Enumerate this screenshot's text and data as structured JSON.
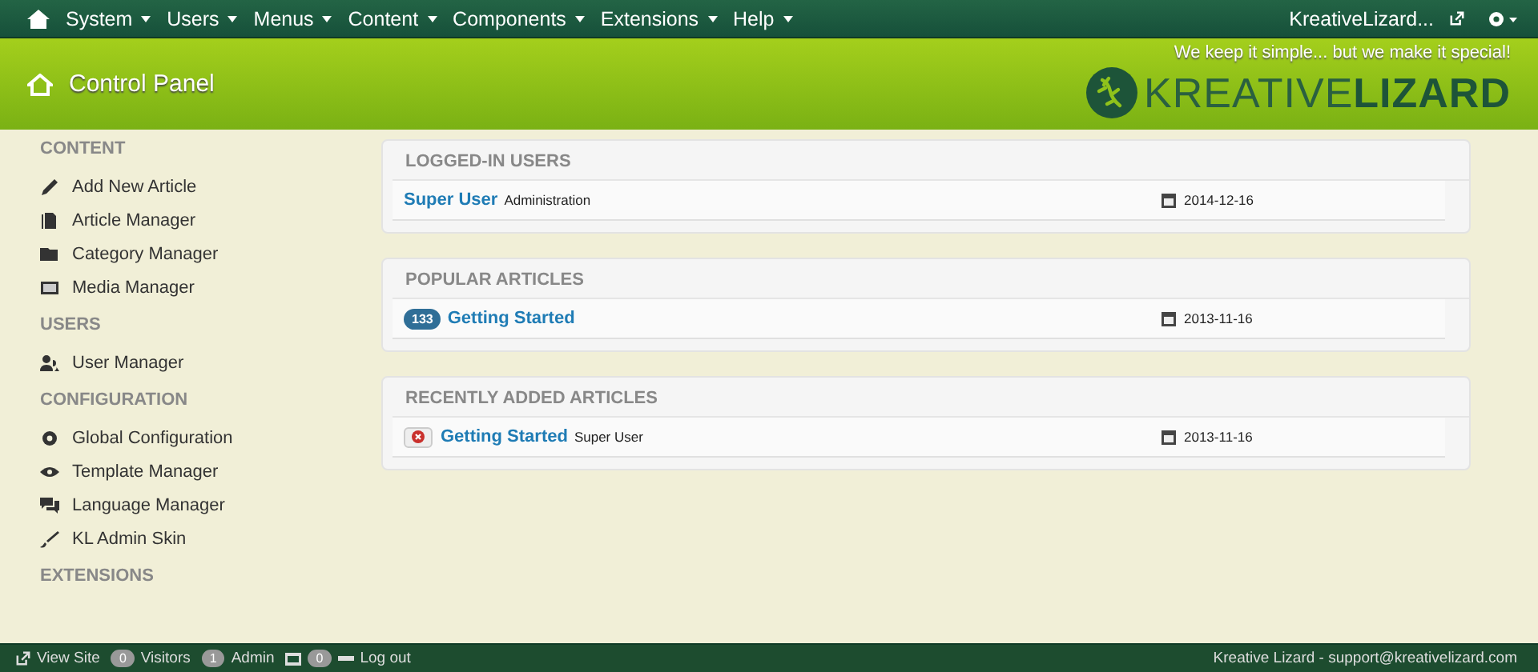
{
  "nav": {
    "menus": [
      "System",
      "Users",
      "Menus",
      "Content",
      "Components",
      "Extensions",
      "Help"
    ],
    "site_link": "KreativeLizard..."
  },
  "header": {
    "title": "Control Panel",
    "tagline": "We keep it simple... but we make it special!",
    "logo": {
      "light": "KREATIVE",
      "bold": "LIZARD"
    }
  },
  "sidebar": [
    {
      "heading": "CONTENT",
      "items": [
        "Add New Article",
        "Article Manager",
        "Category Manager",
        "Media Manager"
      ]
    },
    {
      "heading": "USERS",
      "items": [
        "User Manager"
      ]
    },
    {
      "heading": "CONFIGURATION",
      "items": [
        "Global Configuration",
        "Template Manager",
        "Language Manager",
        "KL Admin Skin"
      ]
    },
    {
      "heading": "EXTENSIONS"
    }
  ],
  "panels": [
    {
      "title": "LOGGED-IN USERS",
      "rows": [
        {
          "kind": "user",
          "link": "Super User",
          "note": "Administration",
          "date": "2014-12-16"
        }
      ]
    },
    {
      "title": "POPULAR ARTICLES",
      "rows": [
        {
          "kind": "hits",
          "badge": "133",
          "link": "Getting Started",
          "date": "2013-11-16"
        }
      ]
    },
    {
      "title": "RECENTLY ADDED ARTICLES",
      "rows": [
        {
          "kind": "unpublished",
          "link": "Getting Started",
          "note": "Super User",
          "date": "2013-11-16"
        }
      ]
    }
  ],
  "status_bar": {
    "view_site": "View Site",
    "visitors_count": "0",
    "visitors": "Visitors",
    "admin_count": "1",
    "admin": "Admin",
    "messages_count": "0",
    "logout": "Log out",
    "contact": "Kreative Lizard - support@kreativelizard.com"
  }
}
